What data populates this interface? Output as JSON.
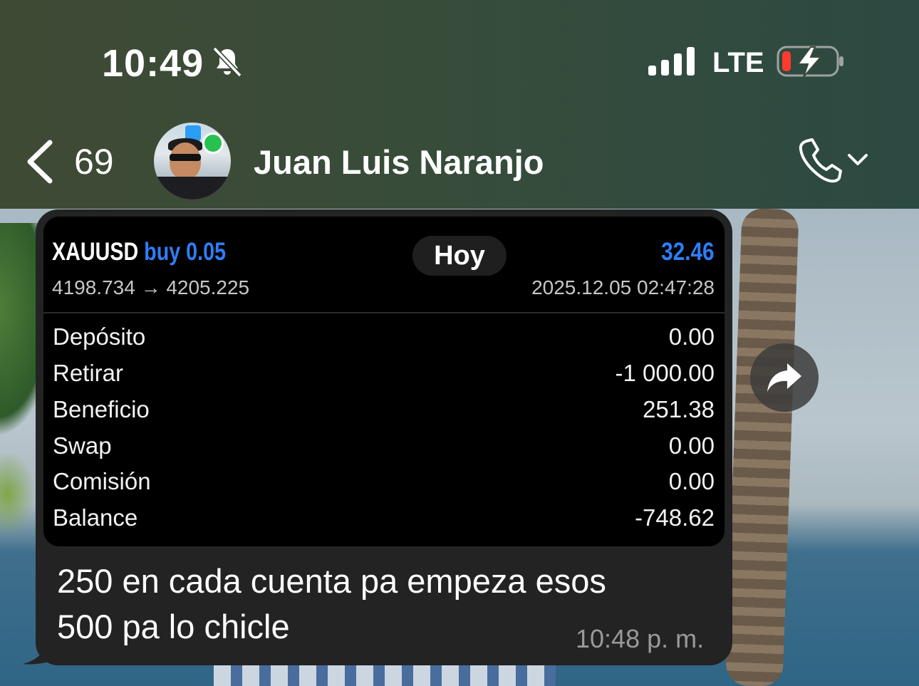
{
  "status_bar": {
    "time": "10:49",
    "network": "LTE",
    "icons": [
      "bell-slash-icon",
      "signal-icon",
      "battery-charging-icon"
    ],
    "battery_color": "#ff3b30"
  },
  "header": {
    "back_count": "69",
    "contact_name": "Juan Luis Naranjo",
    "icons": [
      "chevron-left-icon",
      "phone-icon",
      "chevron-down-icon"
    ]
  },
  "date_pill": "Hoy",
  "trade_card": {
    "symbol": "XAUUSD",
    "action": "buy 0.05",
    "profit": "32.46",
    "prices": "4198.734 → 4205.225",
    "datetime": "2025.12.05 02:47:28",
    "accent_color": "#2f7df6",
    "rows": [
      {
        "label": "Depósito",
        "value": "0.00"
      },
      {
        "label": "Retirar",
        "value": "-1 000.00"
      },
      {
        "label": "Beneficio",
        "value": "251.38"
      },
      {
        "label": "Swap",
        "value": "0.00"
      },
      {
        "label": "Comisión",
        "value": "0.00"
      },
      {
        "label": "Balance",
        "value": "-748.62"
      }
    ]
  },
  "message": {
    "line1": "250 en cada cuenta pa empeza esos",
    "line2": "500 pa lo chicle",
    "time": "10:48 p. m."
  },
  "forward_icon": "forward-arrow-icon"
}
